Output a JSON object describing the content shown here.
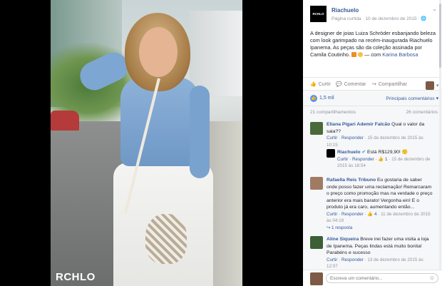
{
  "photo": {
    "watermark": "RCHLO"
  },
  "page": {
    "name": "Riachuelo",
    "logo_text": "RCHLO",
    "meta": "Página curtida · 10 de dezembro de 2015 · ",
    "globe": "🌐"
  },
  "post": {
    "text": "A designer de joias Luiza Schröder esbanjando beleza com look garimpado na recém-inaugurada Riachuelo Ipanema. As peças são da coleção assinada por Camila Coutinho.",
    "with_sep": " — com",
    "tagged": "Karina Barbosa"
  },
  "actions": {
    "like": "Curtir",
    "comment": "Comentar",
    "share": "Compartilhar"
  },
  "stats": {
    "likes": "1,5 mil",
    "sort": "Principais comentários ▾",
    "shares": "21 compartilhamentos",
    "comments_count": "26 comentários"
  },
  "comments": [
    {
      "author": "Eliana Pigari Ademir Falcão",
      "text": " Qual o valor da saia??",
      "actions": "Curtir · Responder",
      "date": " · 15 de dezembro de 2015 às 10:15"
    },
    {
      "author": "Riachuelo",
      "verified": "✔",
      "text": " Está R$129,90! 🙂",
      "actions": "Curtir · Responder · ",
      "likes": "👍 1",
      "date": " · 15 de dezembro de 2015 às 18:54"
    },
    {
      "author": "Rafaella Reis Tribuno",
      "text": " Eu gostaria de saber onde posso fazer uma reclamação! Remarcaram o preço como promoção mas na verdade o preço anterior era mais barato! Vergonha ein! E o produto já era caro, aumentando então...",
      "actions": "Curtir · Responder · ",
      "likes": "👍 4",
      "date": " · 11 de dezembro de 2015 às 04:19",
      "replies": "↪ 1 resposta"
    },
    {
      "author": "Aline Siqueira",
      "text": " Breve irei fazer uma visita a loja de Ipanema. Peças lindas está muito bonita! Parabéns e sucesso",
      "actions": "Curtir · Responder",
      "date": " · 13 de dezembro de 2015 às 12:07"
    }
  ],
  "input": {
    "placeholder": "Escreva um comentário..."
  },
  "colors": {
    "link": "#365899",
    "meta": "#90949c",
    "like_icon": "#5890ff"
  }
}
